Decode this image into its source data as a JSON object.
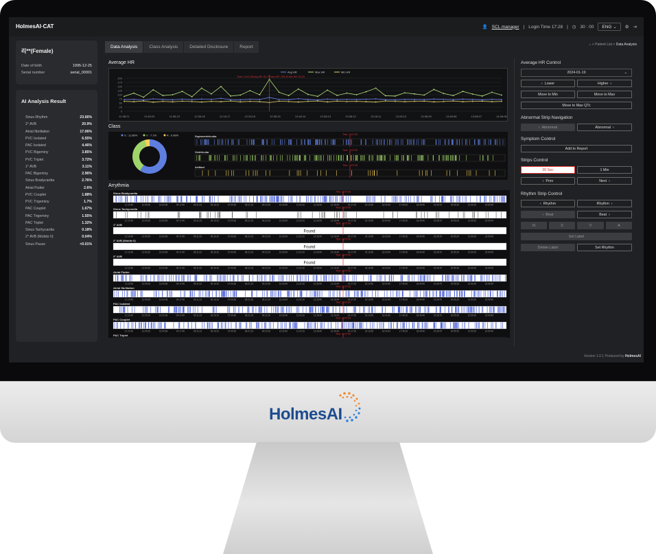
{
  "app": {
    "brand": "HolmesAI·CAT",
    "user": "SCL manager",
    "login_time": "Login Time 17:28",
    "timer": "30 : 00",
    "lang": "ENG"
  },
  "patient": {
    "name": "리**(Female)",
    "dob_label": "Date of birth",
    "dob": "1995-12-25",
    "serial_label": "Serial number",
    "serial": "serial_00001"
  },
  "ai_result": {
    "title": "AI Analysis Result",
    "items": [
      {
        "label": "Sinus Rhythm",
        "value": "23.66%"
      },
      {
        "label": "2° AVB",
        "value": "20.9%"
      },
      {
        "label": "Atrial fibrillation",
        "value": "17.06%"
      },
      {
        "label": "PVC Isolated",
        "value": "6.55%"
      },
      {
        "label": "PAC Isolated",
        "value": "4.46%"
      },
      {
        "label": "PVC Bigeminy",
        "value": "3.85%"
      },
      {
        "label": "PVC Triplet",
        "value": "3.72%"
      },
      {
        "label": "1° AVB",
        "value": "3.11%"
      },
      {
        "label": "PAC Bigeminy",
        "value": "2.96%"
      },
      {
        "label": "Sinus Bradycardia",
        "value": "2.76%"
      },
      {
        "label": "Atrial Flutter",
        "value": "2.6%"
      },
      {
        "label": "PVC Couplet",
        "value": "1.88%"
      },
      {
        "label": "PVC Trigeminy",
        "value": "1.7%"
      },
      {
        "label": "PAC Couplet",
        "value": "1.67%"
      },
      {
        "label": "PAC Trigeminy",
        "value": "1.55%"
      },
      {
        "label": "PAC Triplet",
        "value": "1.32%"
      },
      {
        "label": "Sinus Tachycardia",
        "value": "0.18%"
      },
      {
        "label": "2° AVB (Mobitz II)",
        "value": "0.04%"
      },
      {
        "label": "Sinus Pause",
        "value": "<0.01%"
      }
    ]
  },
  "tabs": [
    "Data Analysis",
    "Class Analysis",
    "Detailed Disclosure",
    "Report"
  ],
  "breadcrumb": {
    "parent": "Patient List",
    "current": "Data Analysis"
  },
  "sections": {
    "avg_hr": "Average HR",
    "class": "Class",
    "arrythmia": "Arrythmia"
  },
  "avg_hr_chart": {
    "legend": [
      "Avg HR",
      "Max HR",
      "Min HR"
    ],
    "marker_text": "Time: 13:07:08 Avg HR: 83.77 Max HR: 193.33 Min HR: 53.33",
    "colors": {
      "avg": "#6a7ff0",
      "max": "#b6e07a",
      "min": "#e8d76a",
      "marker": "#e03030"
    },
    "x_ticks": [
      "11:38:21",
      "11:48:20",
      "11:58:19",
      "12:08:18",
      "12:18:17",
      "12:28:16",
      "12:38:15",
      "12:48:14",
      "12:58:13",
      "13:08:12",
      "13:18:11",
      "13:28:10",
      "13:38:09",
      "13:48:08",
      "13:58:07",
      "14:08:06"
    ],
    "y_ticks": [
      "200",
      "175",
      "150",
      "125",
      "100",
      "75",
      "50",
      "25",
      "0"
    ],
    "avg": [
      70,
      72,
      68,
      75,
      71,
      69,
      73,
      70,
      74,
      72,
      78,
      70,
      69,
      73,
      71,
      84,
      72,
      70,
      76,
      71,
      68,
      74,
      70,
      72,
      71,
      73,
      75,
      70,
      69,
      72,
      71,
      70,
      74,
      72,
      70,
      73,
      71,
      69,
      72,
      70
    ],
    "max": [
      90,
      110,
      85,
      130,
      95,
      100,
      120,
      88,
      140,
      105,
      150,
      92,
      98,
      125,
      100,
      193,
      115,
      95,
      135,
      102,
      90,
      128,
      96,
      110,
      100,
      118,
      140,
      94,
      92,
      112,
      105,
      98,
      132,
      108,
      95,
      120,
      104,
      92,
      115,
      98
    ],
    "min": [
      60,
      58,
      62,
      55,
      60,
      57,
      61,
      59,
      56,
      60,
      58,
      62,
      57,
      60,
      58,
      53,
      61,
      59,
      56,
      60,
      62,
      57,
      61,
      59,
      60,
      58,
      56,
      62,
      60,
      58,
      60,
      61,
      57,
      59,
      62,
      58,
      60,
      61,
      58,
      60
    ]
  },
  "class_chart": {
    "legend": [
      "S : 11.86%",
      "V : 7.1%",
      "A : 0.98%"
    ],
    "values": [
      11.86,
      7.1,
      0.98
    ],
    "colors": [
      "#5f7fe0",
      "#9fd46a",
      "#f5d35a"
    ],
    "rows": [
      "Supraventricular",
      "Ventricular",
      "Artifact"
    ],
    "time_label": "Time: 13:07:08"
  },
  "arrythmia": {
    "rows": [
      "Sinus Bradycardia",
      "Sinus Tachycardia",
      "1° AVB",
      "2° AVB (Mobitz II)",
      "3° AVB",
      "Atrial Flutter",
      "Atrial fibrillation",
      "PAC Isolated",
      "PAC Couplet",
      "PAC Triplet"
    ],
    "found_label": "Found",
    "time_label": "Time: 13:07:08",
    "ticks": [
      "11:10:46",
      "12:05:20",
      "13:00:08",
      "04:17:40",
      "05:11:23",
      "06:16:10",
      "07:09:30",
      "08:21:23",
      "09:22:20",
      "10:26:40",
      "11:02:10",
      "12:28:40",
      "13:16:44",
      "14:17:20",
      "15:10:50",
      "16:42:40",
      "17:45:20",
      "18:49:40",
      "19:28:70",
      "20:55:20",
      "21:59:20",
      "22:59:40"
    ]
  },
  "right": {
    "hr_title": "Average HR Control",
    "date": "2024-01-19",
    "lower": "Lower",
    "higher": "Higher",
    "move_min": "Move to Min",
    "move_max": "Move to Max",
    "move_max_qtc": "Move to Max QTc",
    "abn_title": "Abnormal Strip Navigation",
    "abn_prev": "Abnormal",
    "abn_next": "Abnormal",
    "sym_title": "Symptom Control",
    "add_report": "Add to Report",
    "strips_title": "Strips Control",
    "s30": "30 Sec",
    "m1": "1 Min",
    "prev": "Prev",
    "next": "Next",
    "rhythm_title": "Rhythm Strip Control",
    "rhythm_prev": "Rhythm",
    "rhythm_next": "Rhythm",
    "beat_prev": "Beat",
    "beat_next": "Beat",
    "labels": [
      "N",
      "S",
      "V",
      "A"
    ],
    "set_label": "Set Label",
    "delete_label": "Delete Label",
    "set_rhythm": "Set Rhythm"
  },
  "footer": {
    "version": "Version 1.0.1 Produced by",
    "brand": "HolmesAI"
  },
  "monitor_logo": "HolmesAI"
}
